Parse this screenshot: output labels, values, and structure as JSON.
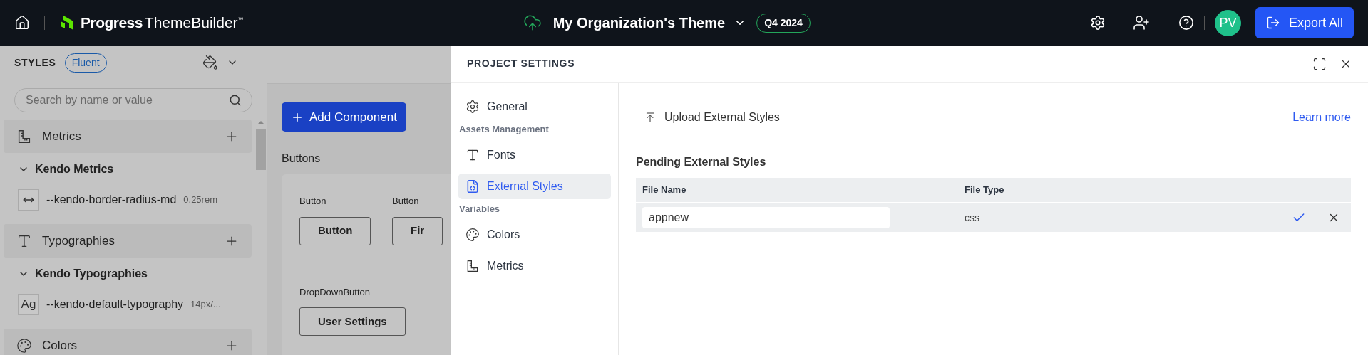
{
  "topbar": {
    "brand": "Progress",
    "product": "ThemeBuilder",
    "trademark": "™",
    "theme_name": "My Organization's Theme",
    "release_badge": "Q4 2024",
    "avatar": "PV",
    "export_button": "Export All"
  },
  "sidebar": {
    "label": "STYLES",
    "style_badge": "Fluent",
    "search": {
      "placeholder": "Search by name or value"
    },
    "sections": [
      {
        "kind": "metrics",
        "title": "Metrics",
        "group": {
          "title": "Kendo Metrics",
          "expanded": true,
          "items": [
            {
              "name": "--kendo-border-radius-md",
              "value": "0.25rem"
            }
          ]
        }
      },
      {
        "kind": "typography",
        "title": "Typographies",
        "group": {
          "title": "Kendo Typographies",
          "expanded": true,
          "items": [
            {
              "swatch": "Ag",
              "name": "--kendo-default-typography",
              "value": "14px/..."
            }
          ]
        }
      },
      {
        "kind": "colors",
        "title": "Colors"
      }
    ]
  },
  "canvas": {
    "add_button": "Add Component",
    "section_title": "Buttons",
    "demos": [
      {
        "label": "Button",
        "button": "Button"
      },
      {
        "label": "Button",
        "button": "Fir"
      },
      {
        "label": "DropDownButton",
        "button": "User Settings"
      }
    ]
  },
  "modal": {
    "title": "PROJECT SETTINGS",
    "nav": [
      {
        "kind": "general",
        "label": "General",
        "selected": false
      },
      {
        "kind": "heading",
        "label": "Assets Management"
      },
      {
        "kind": "fonts",
        "label": "Fonts",
        "selected": false
      },
      {
        "kind": "external",
        "label": "External Styles",
        "selected": true
      },
      {
        "kind": "heading",
        "label": "Variables"
      },
      {
        "kind": "colors",
        "label": "Colors",
        "selected": false
      },
      {
        "kind": "metrics",
        "label": "Metrics",
        "selected": false
      }
    ],
    "upload_button": "Upload External Styles",
    "learn_more": "Learn more",
    "table_title": "Pending External Styles",
    "table": {
      "columns": [
        "File Name",
        "File Type"
      ],
      "rows": [
        {
          "file_name": "appnew",
          "file_type": "css"
        }
      ]
    }
  }
}
